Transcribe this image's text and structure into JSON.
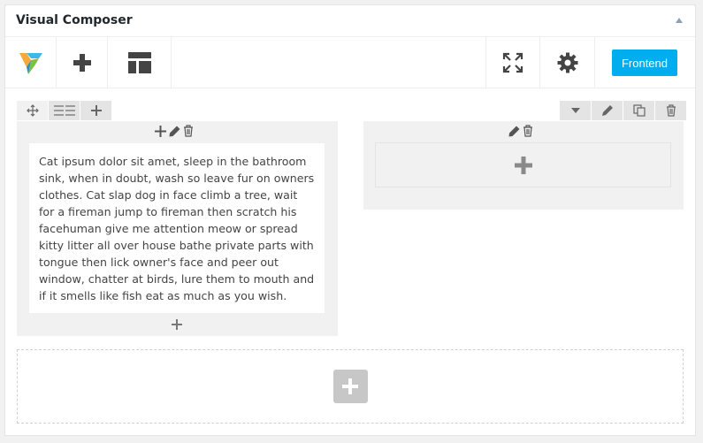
{
  "header": {
    "title": "Visual Composer"
  },
  "toolbar": {
    "frontend_label": "Frontend",
    "icons": [
      "vc-logo-icon",
      "add-element-icon",
      "templates-icon",
      "fullscreen-icon",
      "settings-gear-icon"
    ]
  },
  "row": {
    "controls": [
      "move-icon",
      "column-layout-icon",
      "add-column-icon"
    ],
    "right_controls": [
      "toggle-row-icon",
      "edit-row-icon",
      "clone-row-icon",
      "delete-row-icon"
    ]
  },
  "columns": [
    {
      "text": "Cat ipsum dolor sit amet, sleep in the bathroom sink, when in doubt, wash so leave fur on owners clothes. Cat slap dog in face climb a tree, wait for a fireman jump to fireman then scratch his facehuman give me attention meow or spread kitty litter all over house bathe private parts with tongue then lick owner's face and peer out window, chatter at birds, lure them to mouth and if it smells like fish eat as much as you wish."
    },
    {
      "empty": true
    }
  ],
  "colors": {
    "accent": "#00aef0",
    "column_bg": "#f1f1f1",
    "icon_dark": "#444444"
  }
}
